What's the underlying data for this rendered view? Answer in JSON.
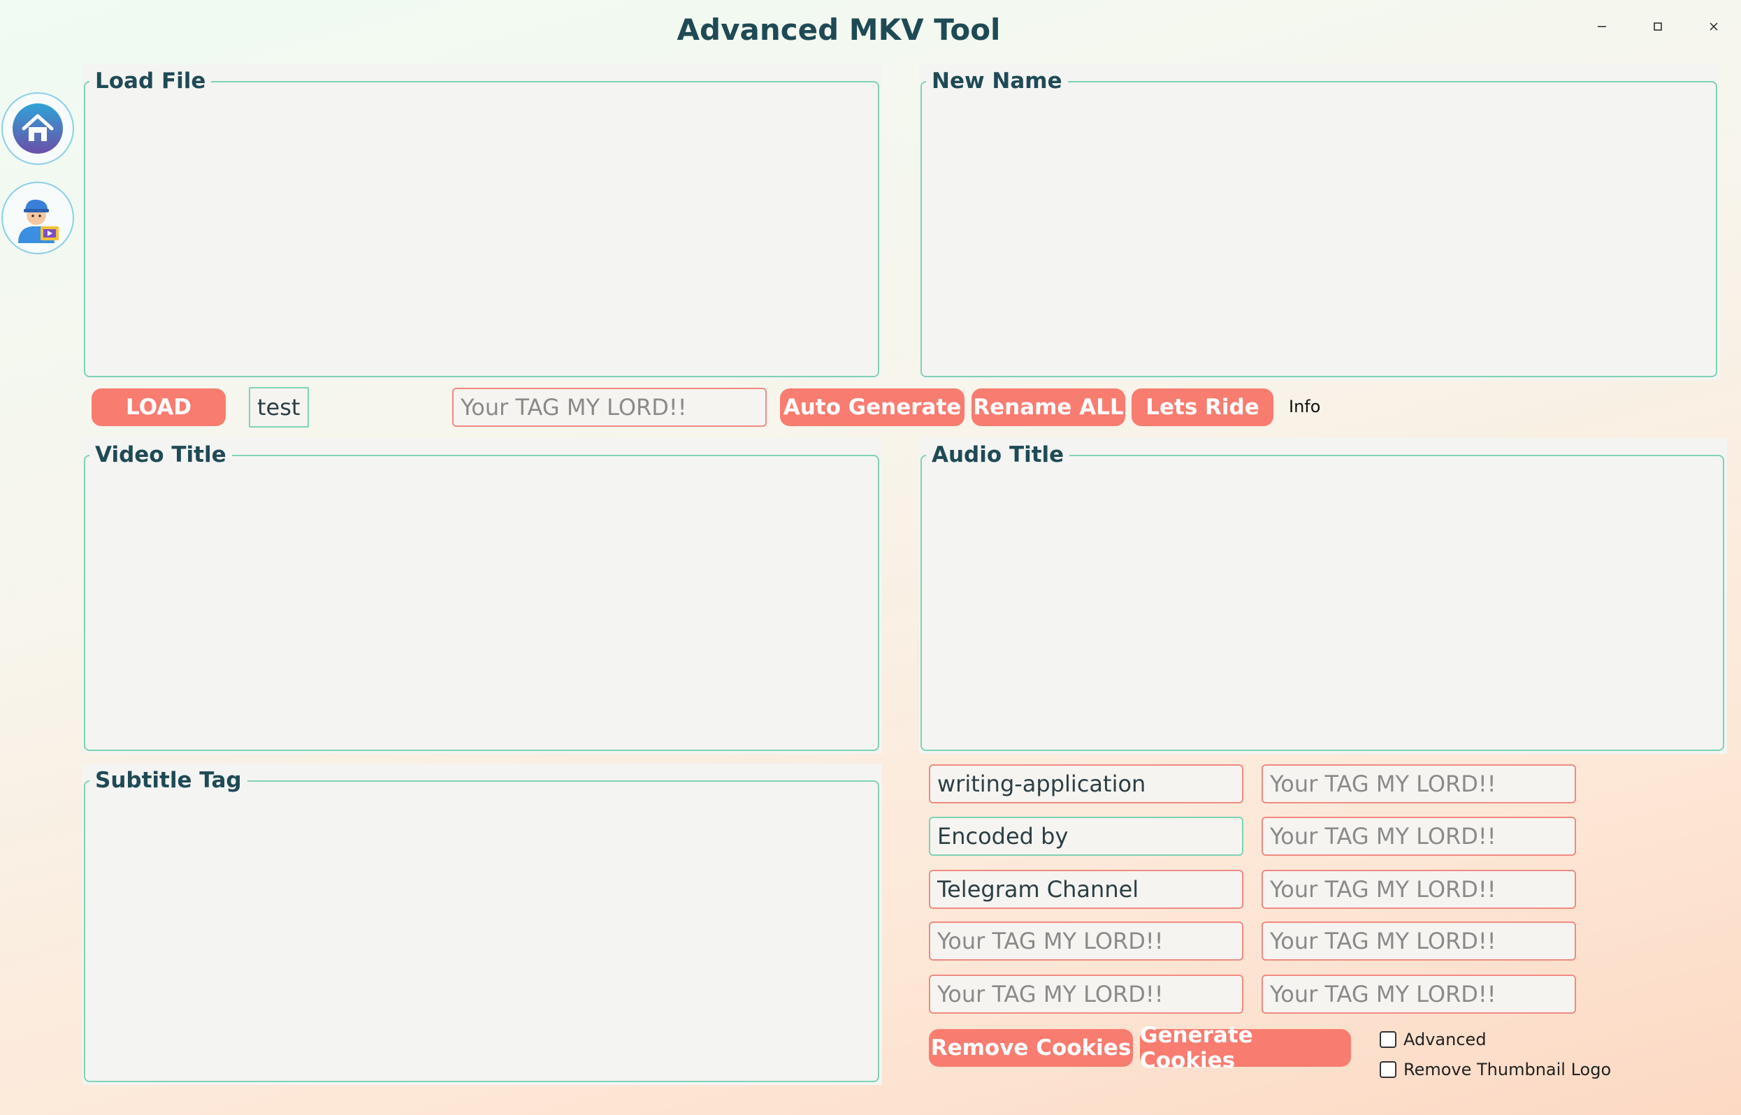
{
  "window": {
    "title": "Advanced MKV Tool"
  },
  "nav": {
    "home_icon": "home-icon",
    "profile_icon": "user-avatar-icon"
  },
  "groups": {
    "load_file": "Load File",
    "new_name": "New Name",
    "video_title": "Video Title",
    "audio_title": "Audio Title",
    "subtitle_tag": "Subtitle Tag"
  },
  "toolbar": {
    "load_label": "LOAD",
    "test_value": "test",
    "tag_placeholder": "Your TAG MY LORD!!",
    "auto_generate_label": "Auto Generate",
    "rename_all_label": "Rename ALL",
    "lets_ride_label": "Lets Ride",
    "info_label": "Info"
  },
  "tags": {
    "left": [
      {
        "value": "writing-application",
        "placeholder": ""
      },
      {
        "value": "Encoded by",
        "placeholder": ""
      },
      {
        "value": "Telegram Channel",
        "placeholder": ""
      },
      {
        "value": "",
        "placeholder": "Your TAG MY LORD!!"
      },
      {
        "value": "",
        "placeholder": "Your TAG MY LORD!!"
      }
    ],
    "right": [
      {
        "value": "",
        "placeholder": "Your TAG MY LORD!!"
      },
      {
        "value": "",
        "placeholder": "Your TAG MY LORD!!"
      },
      {
        "value": "",
        "placeholder": "Your TAG MY LORD!!"
      },
      {
        "value": "",
        "placeholder": "Your TAG MY LORD!!"
      },
      {
        "value": "",
        "placeholder": "Your TAG MY LORD!!"
      }
    ]
  },
  "actions": {
    "remove_cookies_label": "Remove Cookies",
    "generate_cookies_label": "Generate Cookies",
    "advanced_label": "Advanced",
    "remove_thumbnail_logo_label": "Remove Thumbnail Logo"
  },
  "colors": {
    "accent": "#f87c70",
    "border": "#7fd2b5",
    "text": "#1f4a55"
  }
}
